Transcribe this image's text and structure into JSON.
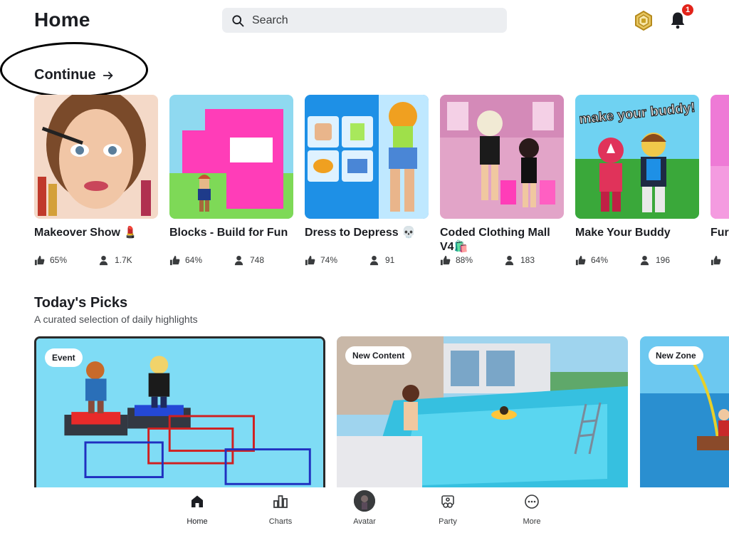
{
  "header": {
    "title": "Home",
    "search_placeholder": "Search",
    "notification_count": "1"
  },
  "continue_section": {
    "label": "Continue",
    "games": [
      {
        "name": "Makeover Show 💄",
        "rating": "65%",
        "players": "1.7K"
      },
      {
        "name": "Blocks - Build for Fun",
        "rating": "64%",
        "players": "748"
      },
      {
        "name": "Dress to Depress 💀",
        "rating": "74%",
        "players": "91"
      },
      {
        "name": "Coded Clothing Mall V4🛍️",
        "rating": "88%",
        "players": "183"
      },
      {
        "name": "Make Your Buddy",
        "rating": "64%",
        "players": "196"
      },
      {
        "name": "Furr [Fur",
        "rating": "",
        "players": ""
      }
    ]
  },
  "todays_picks": {
    "title": "Today's Picks",
    "subtitle": "A curated selection of daily highlights",
    "cards": [
      {
        "badge": "Event"
      },
      {
        "badge": "New Content"
      },
      {
        "badge": "New Zone"
      }
    ]
  },
  "bottom_nav": {
    "items": [
      {
        "label": "Home",
        "icon": "home-icon",
        "active": true
      },
      {
        "label": "Charts",
        "icon": "charts-icon",
        "active": false
      },
      {
        "label": "Avatar",
        "icon": "avatar-icon",
        "active": false
      },
      {
        "label": "Party",
        "icon": "party-icon",
        "active": false
      },
      {
        "label": "More",
        "icon": "more-icon",
        "active": false
      }
    ]
  },
  "thumbnail_text": {
    "make_your_buddy": "make your buddy!"
  },
  "colors": {
    "accent_badge": "#e2231a",
    "search_bg": "#eceef1",
    "robux_gold": "#c9a227"
  }
}
